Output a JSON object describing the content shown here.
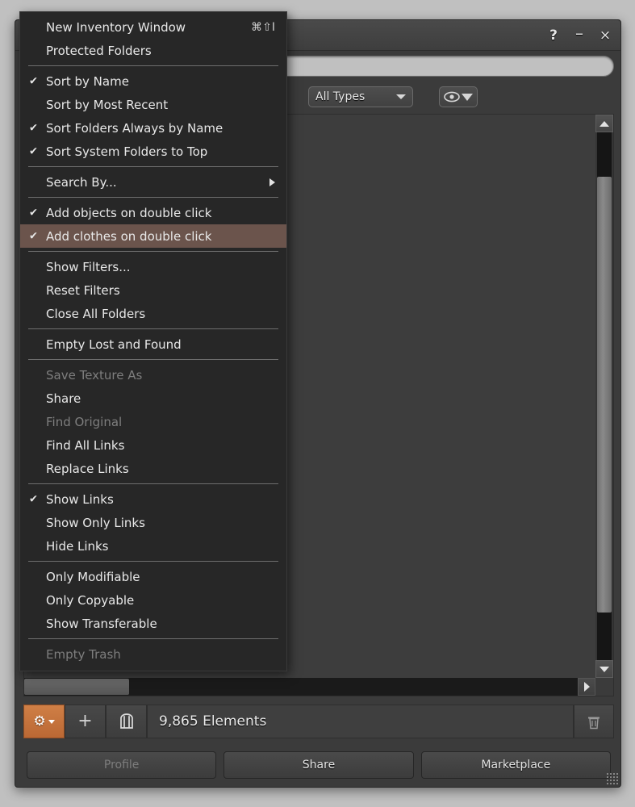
{
  "window": {
    "title": "",
    "controls": [
      {
        "name": "help-button",
        "glyph": "?"
      },
      {
        "name": "minimize-button",
        "glyph": "–"
      },
      {
        "name": "close-button",
        "glyph": "×"
      }
    ]
  },
  "search": {
    "value": "",
    "placeholder": ""
  },
  "filters": {
    "type_combo": {
      "label": "All Types"
    },
    "eye_filter": {
      "icon": "eye-icon",
      "funnel": "funnel-icon"
    }
  },
  "toolbar": {
    "gear_label": "⚙",
    "add_label": "+",
    "wearing_label": "▧",
    "count_text": "9,865 Elements",
    "trash_label": "Ὕ1"
  },
  "actions": [
    {
      "label": "Profile",
      "disabled": true
    },
    {
      "label": "Share",
      "disabled": false
    },
    {
      "label": "Marketplace",
      "disabled": false
    }
  ],
  "menu": {
    "items": [
      {
        "label": "New Inventory Window",
        "checked": false,
        "disabled": false,
        "accel": "⌘⇧I"
      },
      {
        "label": "Protected Folders",
        "checked": false,
        "disabled": false
      },
      {
        "separator": true
      },
      {
        "label": "Sort by Name",
        "checked": true,
        "disabled": false
      },
      {
        "label": "Sort by Most Recent",
        "checked": false,
        "disabled": false
      },
      {
        "label": "Sort Folders Always by Name",
        "checked": true,
        "disabled": false
      },
      {
        "label": "Sort System Folders to Top",
        "checked": true,
        "disabled": false
      },
      {
        "separator": true
      },
      {
        "label": "Search By...",
        "checked": false,
        "disabled": false,
        "submenu": true
      },
      {
        "separator": true
      },
      {
        "label": "Add objects on double click",
        "checked": true,
        "disabled": false
      },
      {
        "label": "Add clothes on double click",
        "checked": true,
        "disabled": false,
        "highlighted": true
      },
      {
        "separator": true
      },
      {
        "label": "Show Filters...",
        "checked": false,
        "disabled": false
      },
      {
        "label": "Reset Filters",
        "checked": false,
        "disabled": false
      },
      {
        "label": "Close All Folders",
        "checked": false,
        "disabled": false
      },
      {
        "separator": true
      },
      {
        "label": "Empty Lost and Found",
        "checked": false,
        "disabled": false
      },
      {
        "separator": true
      },
      {
        "label": "Save Texture As",
        "checked": false,
        "disabled": true
      },
      {
        "label": "Share",
        "checked": false,
        "disabled": false
      },
      {
        "label": "Find Original",
        "checked": false,
        "disabled": true
      },
      {
        "label": "Find All Links",
        "checked": false,
        "disabled": false
      },
      {
        "label": "Replace Links",
        "checked": false,
        "disabled": false
      },
      {
        "separator": true
      },
      {
        "label": "Show Links",
        "checked": true,
        "disabled": false
      },
      {
        "label": "Show Only Links",
        "checked": false,
        "disabled": false
      },
      {
        "label": "Hide Links",
        "checked": false,
        "disabled": false
      },
      {
        "separator": true
      },
      {
        "label": "Only Modifiable",
        "checked": false,
        "disabled": false
      },
      {
        "label": "Only Copyable",
        "checked": false,
        "disabled": false
      },
      {
        "label": "Show Transferable",
        "checked": false,
        "disabled": false
      },
      {
        "separator": true
      },
      {
        "label": "Empty Trash",
        "checked": false,
        "disabled": true
      }
    ]
  },
  "colors": {
    "menu_bg": "#272727",
    "menu_highlight": "#6b544c",
    "window_bg": "#3b3b3b",
    "accent_orange": "#c4713c",
    "desktop_bg": "#c0c0c0"
  }
}
